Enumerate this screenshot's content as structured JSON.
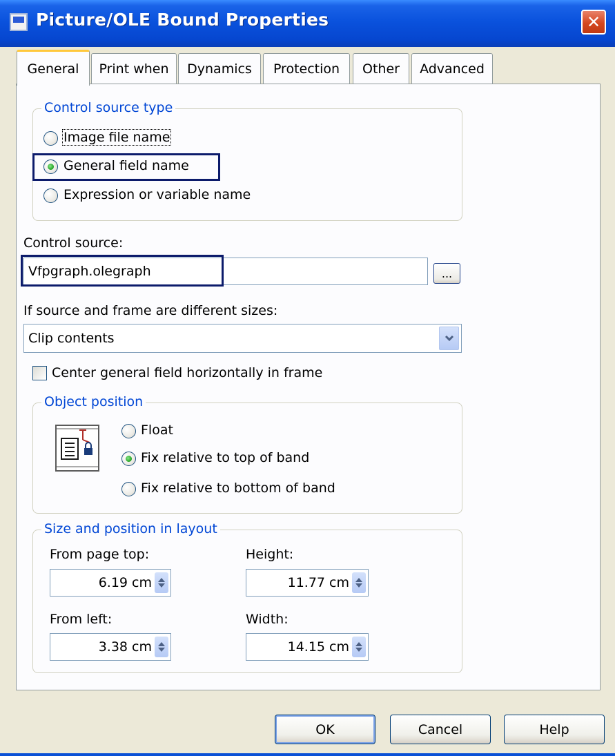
{
  "window": {
    "title": "Picture/OLE Bound Properties",
    "close_glyph": "✕"
  },
  "tabs": [
    "General",
    "Print when",
    "Dynamics",
    "Protection",
    "Other",
    "Advanced"
  ],
  "active_tab": "General",
  "control_source_type": {
    "legend": "Control source type",
    "options": [
      "Image file name",
      "General field name",
      "Expression or variable name"
    ],
    "selected": "General field name"
  },
  "control_source": {
    "label": "Control source:",
    "value": "Vfpgraph.olegraph",
    "browse_label": "..."
  },
  "size_mismatch": {
    "label": "If source and frame are different sizes:",
    "selected": "Clip contents"
  },
  "center_checkbox": {
    "label": "Center general field horizontally in frame",
    "checked": false
  },
  "object_position": {
    "legend": "Object position",
    "icon": "report-band-lock-icon",
    "options": [
      "Float",
      "Fix relative to top of band",
      "Fix relative to bottom of band"
    ],
    "selected": "Fix relative to top of band"
  },
  "size_position": {
    "legend": "Size and position in layout",
    "from_page_top_label": "From page top:",
    "from_page_top": "6.19 cm",
    "height_label": "Height:",
    "height": "11.77 cm",
    "from_left_label": "From left:",
    "from_left": "3.38 cm",
    "width_label": "Width:",
    "width": "14.15 cm"
  },
  "buttons": {
    "ok": "OK",
    "cancel": "Cancel",
    "help": "Help"
  },
  "colors": {
    "titlebar": "#0A52DD",
    "dialog_bg": "#ECE9D8",
    "group_legend": "#0046D5",
    "highlight_border": "#0C1B6B",
    "active_tab_accent": "#FFC83C"
  }
}
